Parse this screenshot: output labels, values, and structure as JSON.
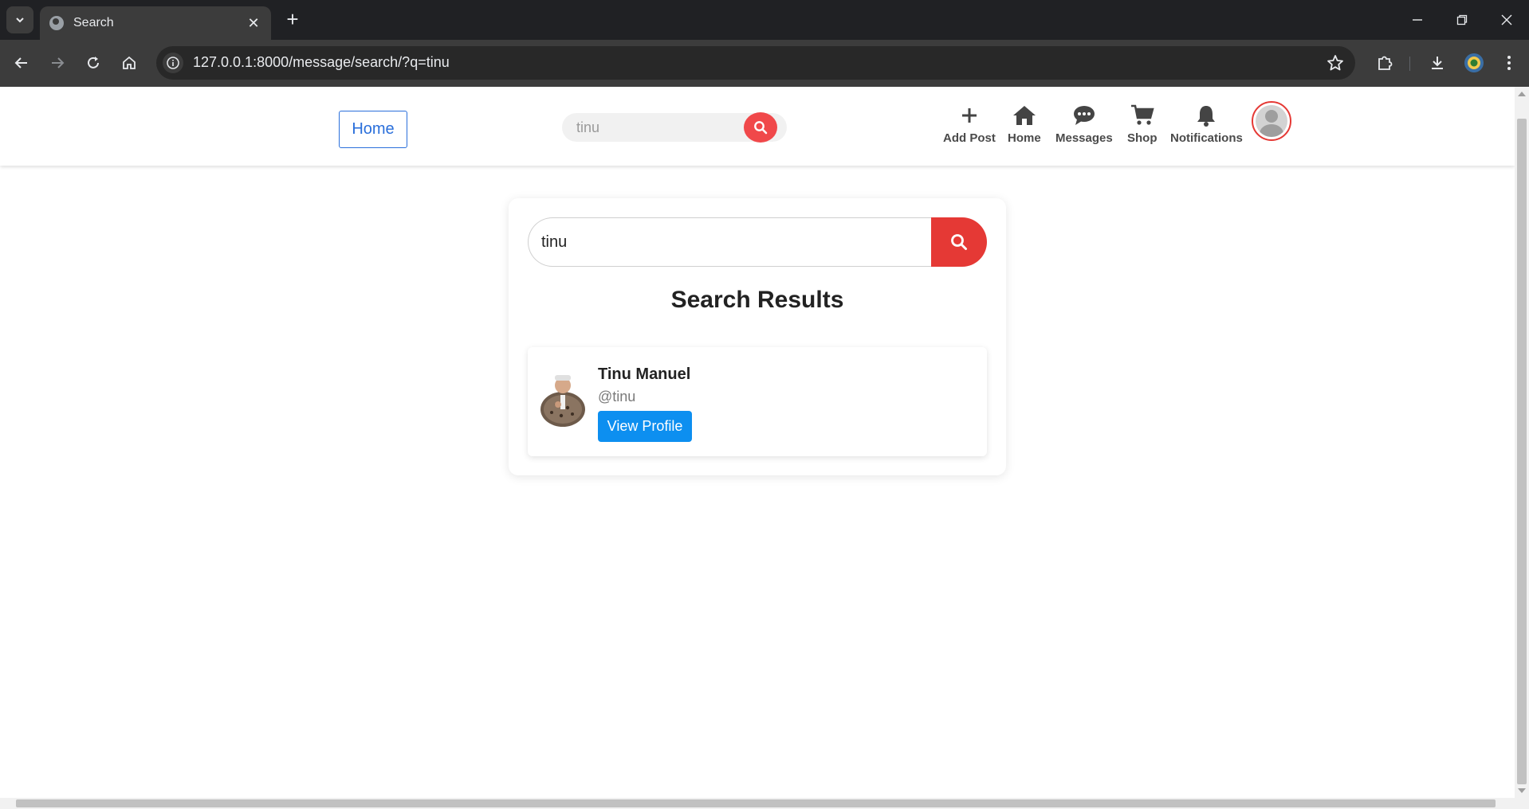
{
  "browser": {
    "tab_title": "Search",
    "url": "127.0.0.1:8000/message/search/?q=tinu"
  },
  "header": {
    "home_button": "Home",
    "search_value": "",
    "search_placeholder": "tinu",
    "nav": {
      "add_post": "Add Post",
      "home": "Home",
      "messages": "Messages",
      "shop": "Shop",
      "notifications": "Notifications"
    }
  },
  "main": {
    "search_value": "tinu",
    "results_title": "Search Results",
    "results": [
      {
        "name": "Tinu Manuel",
        "handle": "@tinu",
        "button_label": "View Profile"
      }
    ]
  },
  "colors": {
    "accent_red": "#e53935",
    "link_blue": "#2a6fdb",
    "button_blue": "#0d8ff0"
  }
}
